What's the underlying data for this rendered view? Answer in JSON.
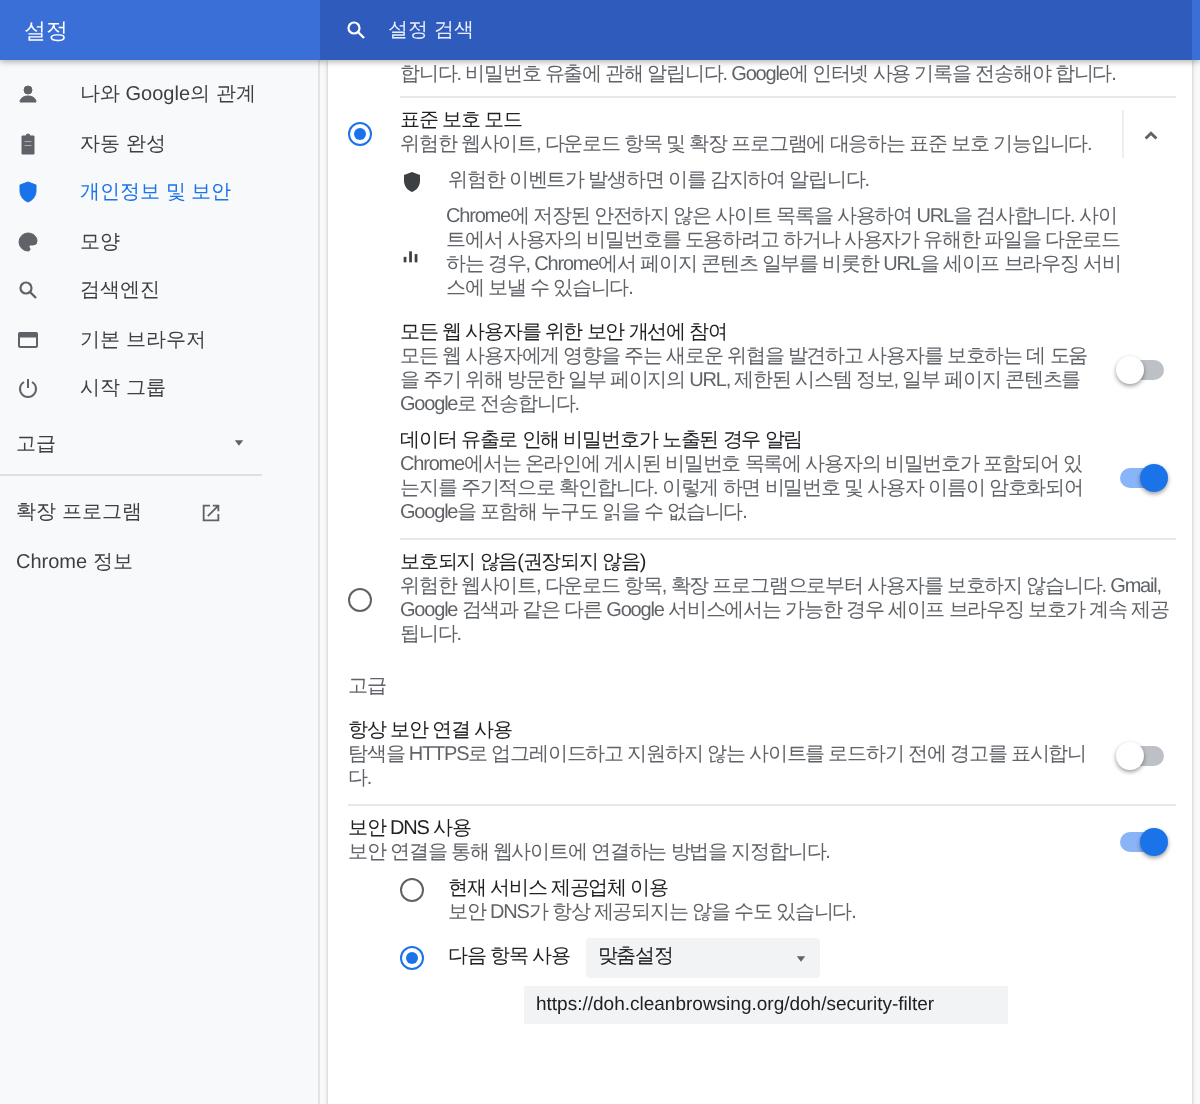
{
  "header": {
    "title": "설정",
    "search": {
      "placeholder": "설정 검색"
    }
  },
  "sidebar": {
    "items": [
      {
        "label": "나와 Google의 관계",
        "selected": false
      },
      {
        "label": "자동 완성",
        "selected": false
      },
      {
        "label": "개인정보 및 보안",
        "selected": true
      },
      {
        "label": "모양",
        "selected": false
      },
      {
        "label": "검색엔진",
        "selected": false
      },
      {
        "label": "기본 브라우저",
        "selected": false
      },
      {
        "label": "시작 그룹",
        "selected": false
      }
    ],
    "advanced": {
      "label": "고급",
      "expanded": false
    },
    "links": [
      {
        "label": "확장 프로그램",
        "external": true
      },
      {
        "label": "Chrome 정보",
        "external": false
      }
    ]
  },
  "main": {
    "cut_text": "합니다. 비밀번호 유출에 관해 알립니다. Google에 인터넷 사용 기록을 전송해야 합니다.",
    "protection_options": [
      {
        "title": "표준 보호 모드",
        "description": "위험한 웹사이트, 다운로드 항목 및 확장 프로그램에 대응하는 표준 보호 기능입니다.",
        "selected": true,
        "expanded": true,
        "details": [
          "위험한 이벤트가 발생하면 이를 감지하여 알립니다.",
          "Chrome에 저장된 안전하지 않은 사이트 목록을 사용하여 URL을 검사합니다. 사이트에서 사용자의 비밀번호를 도용하려고 하거나 사용자가 유해한 파일을 다운로드하는 경우, Chrome에서 페이지 콘텐츠 일부를 비롯한 URL을 세이프 브라우징 서비스에 보낼 수 있습니다."
        ],
        "toggles": [
          {
            "title": "모든 웹 사용자를 위한 보안 개선에 참여",
            "description": "모든 웹 사용자에게 영향을 주는 새로운 위협을 발견하고 사용자를 보호하는 데 도움을 주기 위해 방문한 일부 페이지의 URL, 제한된 시스템 정보, 일부 페이지 콘텐츠를 Google로 전송합니다.",
            "on": false
          },
          {
            "title": "데이터 유출로 인해 비밀번호가 노출된 경우 알림",
            "description": "Chrome에서는 온라인에 게시된 비밀번호 목록에 사용자의 비밀번호가 포함되어 있는지를 주기적으로 확인합니다. 이렇게 하면 비밀번호 및 사용자 이름이 암호화되어 Google을 포함해 누구도 읽을 수 없습니다.",
            "on": true
          }
        ]
      },
      {
        "title": "보호되지 않음(권장되지 않음)",
        "description": "위험한 웹사이트, 다운로드 항목, 확장 프로그램으로부터 사용자를 보호하지 않습니다. Gmail, Google 검색과 같은 다른 Google 서비스에서는 가능한 경우 세이프 브라우징 보호가 계속 제공됩니다.",
        "selected": false,
        "expanded": false
      }
    ],
    "advanced_heading": "고급",
    "settings": [
      {
        "title": "항상 보안 연결 사용",
        "description": "탐색을 HTTPS로 업그레이드하고 지원하지 않는 사이트를 로드하기 전에 경고를 표시합니다.",
        "on": false
      },
      {
        "title": "보안 DNS 사용",
        "description": "보안 연결을 통해 웹사이트에 연결하는 방법을 지정합니다.",
        "on": true,
        "dns_options": [
          {
            "label": "현재 서비스 제공업체 이용",
            "description": "보안 DNS가 항상 제공되지는 않을 수도 있습니다.",
            "selected": false
          },
          {
            "label": "다음 항목 사용",
            "dropdown": "맞춤설정",
            "url": "https://doh.cleanbrowsing.org/doh/security-filter",
            "selected": true
          }
        ]
      }
    ]
  }
}
